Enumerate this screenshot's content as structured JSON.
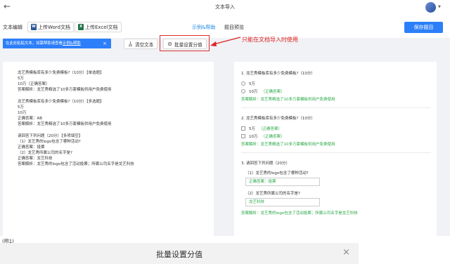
{
  "window": {
    "title": "文本导入",
    "back_icon": "←"
  },
  "toolbar": {
    "label": "文本编辑",
    "upload_word": "上传Word文档",
    "upload_excel": "上传Excel文档",
    "help_link": "示例&帮助",
    "preview_link": "题目预览",
    "save_button": "保存题目",
    "word_icon_letter": "W",
    "excel_icon_letter": "X"
  },
  "infobar": {
    "text": "在此处粘贴文本，如需帮助请查看",
    "link": "示例&帮助",
    "close": "×"
  },
  "actions": {
    "clear_text": "清空文本",
    "batch_score": "批量设置分值",
    "annotation": "只能在文档导入时使用"
  },
  "editor_lines": [
    [
      "龙艺秀模板库有多少免费模板?（10分）【单选题】",
      "5万",
      "10万（正确答案）",
      "答案解析：龙艺秀精选了10多万套模板供用户免费使用"
    ],
    [
      "龙艺秀模板库有多少免费模板?（10分）【多选题】",
      "5万",
      "10万",
      "正确答案：AB",
      "答案解析：龙艺秀精选了10多万套模板供用户免费使用"
    ],
    [
      "请回答下列问题（20分）【多项填空】",
      "（1）龙艺秀的logo包含了哪种活动?",
      "正确答案：投票",
      "（2）龙艺秀所属公司的名字是?",
      "正确答案：龙艺科技",
      "答案解析：龙艺秀的logo包含了活动投票；所属公司名字是龙艺科技"
    ]
  ],
  "preview": {
    "q1": {
      "title": "1. 龙艺秀模板库有多少免费模板?（10分）",
      "options": [
        "5万",
        "10万"
      ],
      "correct_tag": "（正确答案）",
      "analysis": "答案解析：龙艺秀精选了10多万套模板供用户免费使用"
    },
    "q2": {
      "title": "2. 龙艺秀模板库有多少免费模板?（10分）",
      "options": [
        "5万",
        "10万"
      ],
      "correct_tag": "（正确答案）",
      "analysis": "答案解析：龙艺秀精选了10多万套模板供用户免费使用"
    },
    "q3": {
      "title": "3. 请回答下列问题（20分）",
      "sub1": "（1）龙艺秀的logo包含了哪种活动?",
      "ans1": "正确答案：投票",
      "sub2": "（2）龙艺秀所属公司的名字是?",
      "ans2": "龙艺科技",
      "analysis": "答案解析：龙艺秀的logo包含了活动投票；所属公司名字是龙艺科技"
    }
  },
  "figure_caption": "(图1)",
  "dialog": {
    "title": "批量设置分值",
    "close": "×"
  },
  "colors": {
    "accent": "#2d7ff9",
    "annotation": "#e02020",
    "correct": "#28a745"
  }
}
